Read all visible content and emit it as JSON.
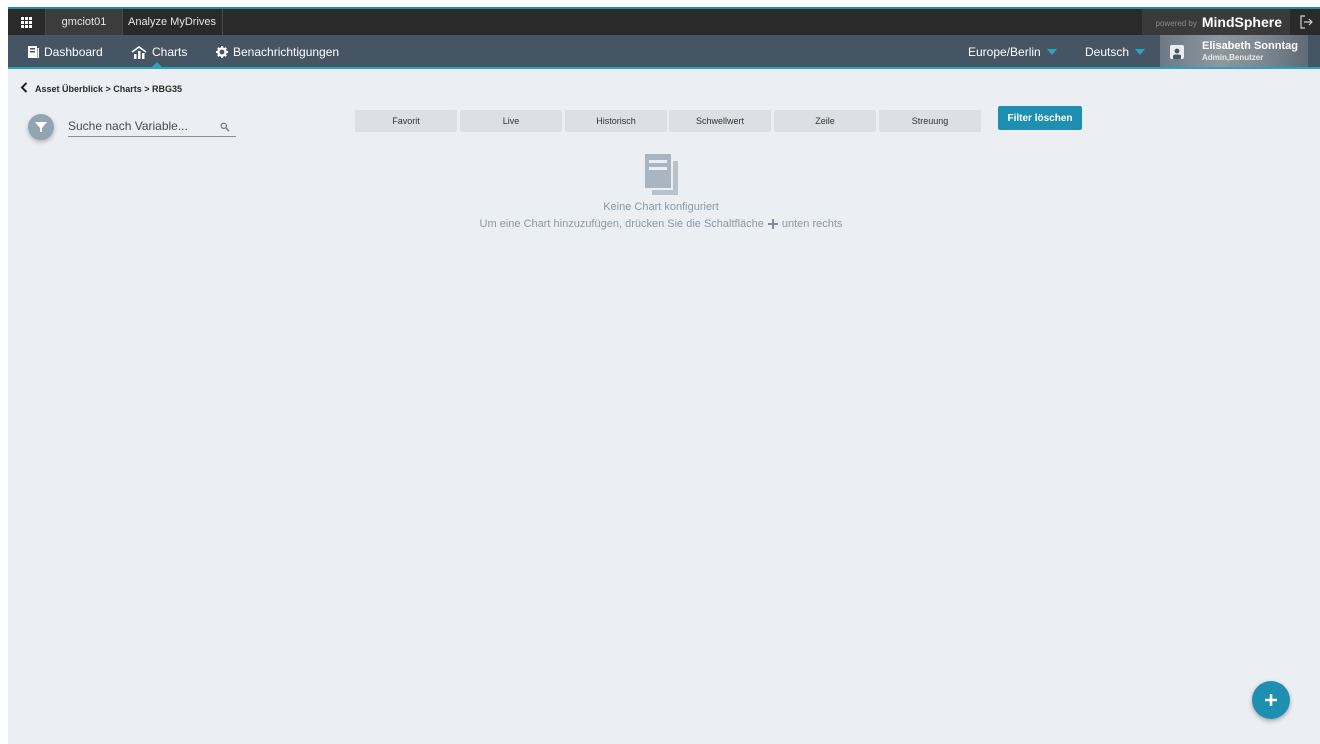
{
  "topbar": {
    "tenant": "gmciot01",
    "app_name": "Analyze MyDrives",
    "powered_by": "powered by",
    "brand": "MindSphere"
  },
  "nav": {
    "items": [
      {
        "label": "Dashboard",
        "icon": "document-icon"
      },
      {
        "label": "Charts",
        "icon": "chart-icon"
      },
      {
        "label": "Benachrichtigungen",
        "icon": "gear-icon"
      }
    ],
    "active": "Charts",
    "timezone": "Europe/Berlin",
    "language": "Deutsch",
    "user": {
      "name": "Elisabeth Sonntag",
      "role": "Admin,Benutzer"
    }
  },
  "breadcrumb": "Asset Überblick > Charts > RBG35",
  "search": {
    "placeholder": "Suche nach Variable..."
  },
  "filters": [
    "Favorit",
    "Live",
    "Historisch",
    "Schwellwert",
    "Zeile",
    "Streuung"
  ],
  "clear_filter_label": "Filter löschen",
  "empty_state": {
    "title": "Keine Chart konfiguriert",
    "hint_before": "Um eine Chart hinzuzufügen, drücken Sie die Schaltfläche",
    "hint_after": "unten rechts"
  },
  "colors": {
    "accent": "#1f8fb1",
    "nav_bg": "#455563",
    "content_bg": "#ebeef2"
  }
}
